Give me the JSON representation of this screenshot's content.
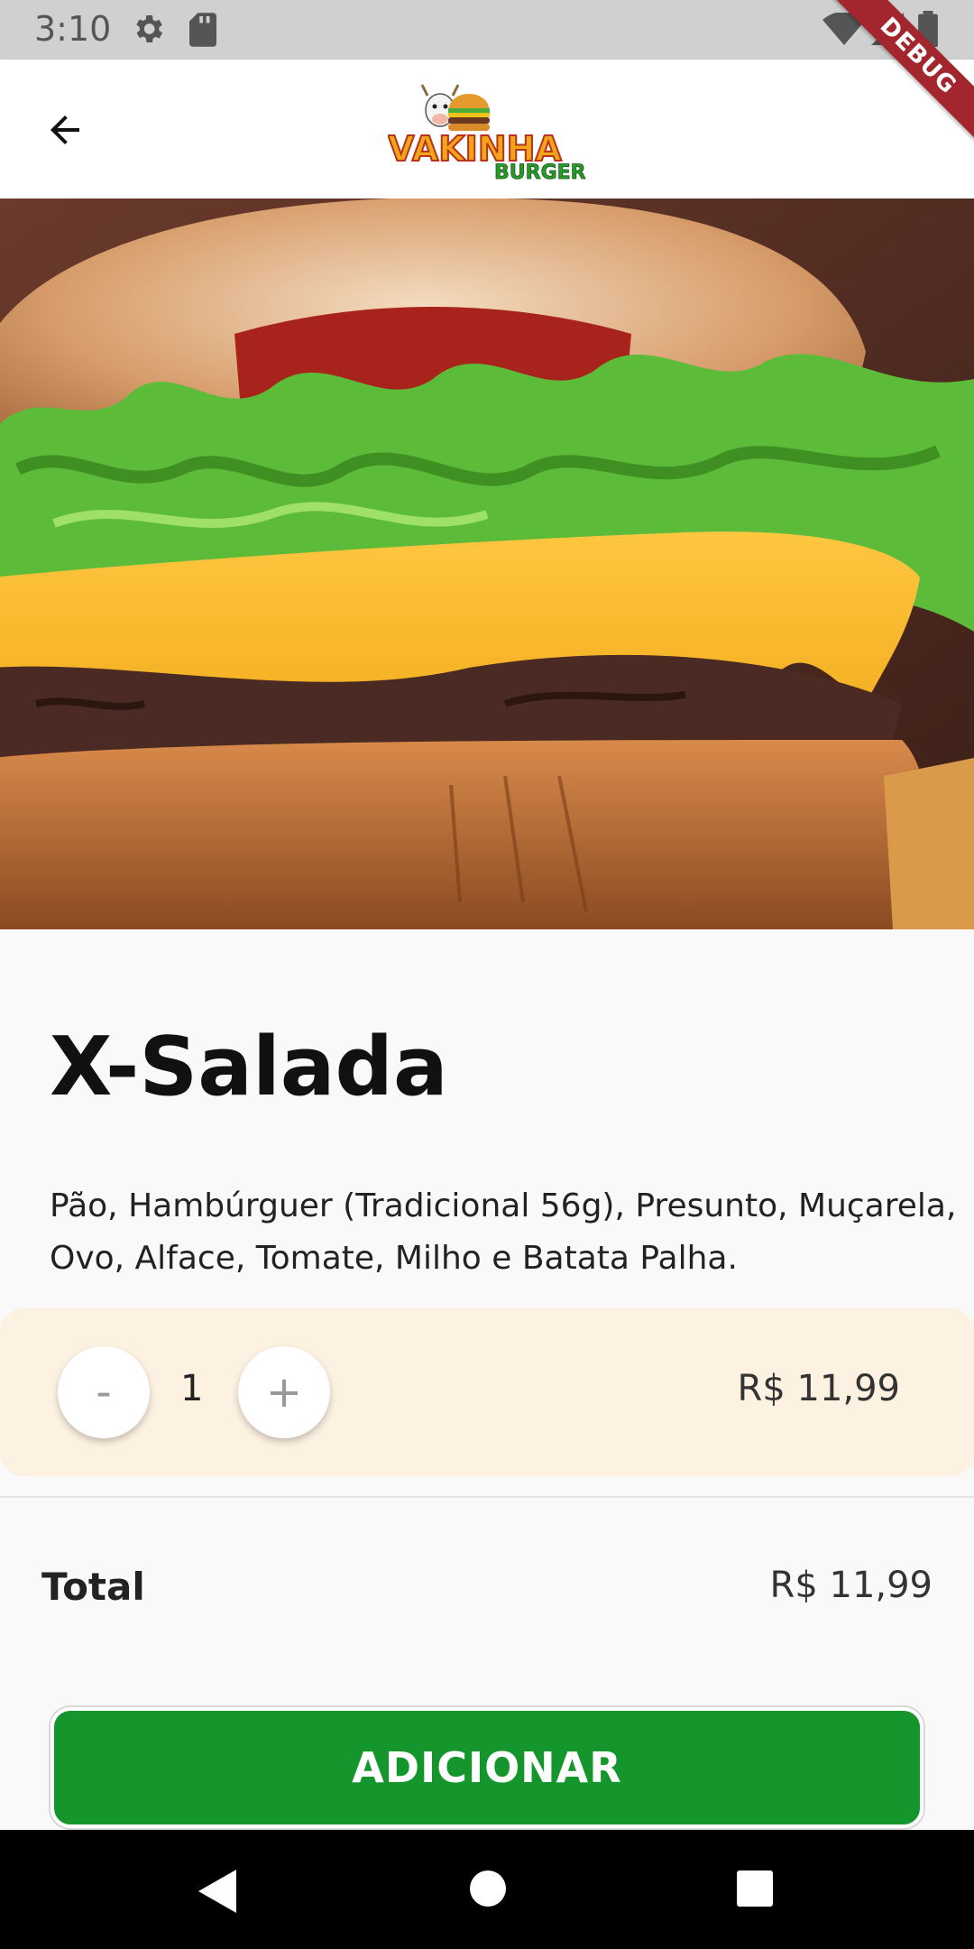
{
  "status_bar": {
    "time": "3:10",
    "icons": [
      "gear-icon",
      "sd-card-icon",
      "wifi-icon",
      "signal-icon",
      "battery-icon"
    ]
  },
  "debug_banner": "DEBUG",
  "app_bar": {
    "back_icon": "arrow-back-icon",
    "logo_text": "VAKINHA",
    "logo_subtext": "BURGER"
  },
  "product": {
    "image": "burger-photo",
    "name": "X-Salada",
    "description": "Pão, Hambúrguer (Tradicional 56g), Presunto, Muçarela, Ovo, Alface, Tomate, Milho e Batata Palha."
  },
  "quantity": {
    "decrement_label": "-",
    "value": "1",
    "increment_label": "+",
    "price": "R$ 11,99"
  },
  "total": {
    "label": "Total",
    "value": "R$ 11,99"
  },
  "add_button": {
    "label": "ADICIONAR"
  },
  "colors": {
    "primary_green": "#15962d",
    "qty_background": "#fdf1e1",
    "debug_ribbon": "#a3262e"
  },
  "nav_bar": {
    "icons": [
      "nav-back-icon",
      "nav-home-icon",
      "nav-recents-icon"
    ]
  }
}
